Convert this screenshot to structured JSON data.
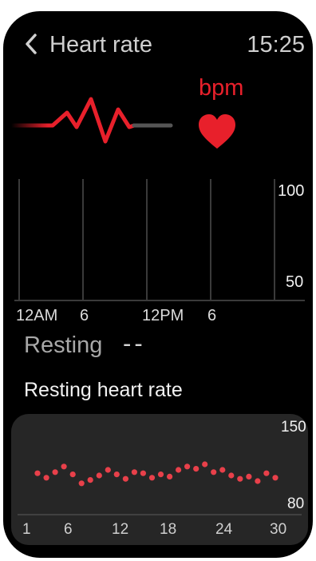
{
  "header": {
    "back_icon": "chevron-left-icon",
    "title": "Heart rate",
    "time": "15:25"
  },
  "hero": {
    "unit": "bpm",
    "heart_icon": "heart-icon",
    "pulse_icon": "pulse-line-icon",
    "accent_color": "#e8202b"
  },
  "day_chart": {
    "x_tick_labels": [
      "12AM",
      "6",
      "12PM",
      "6"
    ],
    "y_tick_labels": [
      "100",
      "50"
    ]
  },
  "resting": {
    "label": "Resting",
    "value": "--"
  },
  "resting_section": {
    "title": "Resting heart rate"
  },
  "chart_data": {
    "type": "scatter",
    "title": "",
    "xlabel": "",
    "ylabel": "",
    "x_ticks": [
      "1",
      "6",
      "12",
      "18",
      "24",
      "30"
    ],
    "y_ticks": [
      "150",
      "80"
    ],
    "xlim": [
      1,
      30
    ],
    "ylim": [
      80,
      150
    ],
    "color": "#e8404a",
    "series": [
      {
        "x": [
          2,
          3,
          4,
          5,
          6,
          7,
          8,
          9,
          10,
          11,
          12,
          13,
          14,
          15,
          16,
          17,
          18,
          19,
          20,
          21,
          22,
          23,
          24,
          25,
          26,
          27,
          28,
          29
        ],
        "y": [
          107,
          103,
          108,
          113,
          106,
          98,
          101,
          105,
          110,
          106,
          102,
          108,
          107,
          103,
          106,
          104,
          110,
          113,
          111,
          115,
          108,
          110,
          105,
          102,
          104,
          100,
          107,
          103
        ]
      }
    ]
  }
}
